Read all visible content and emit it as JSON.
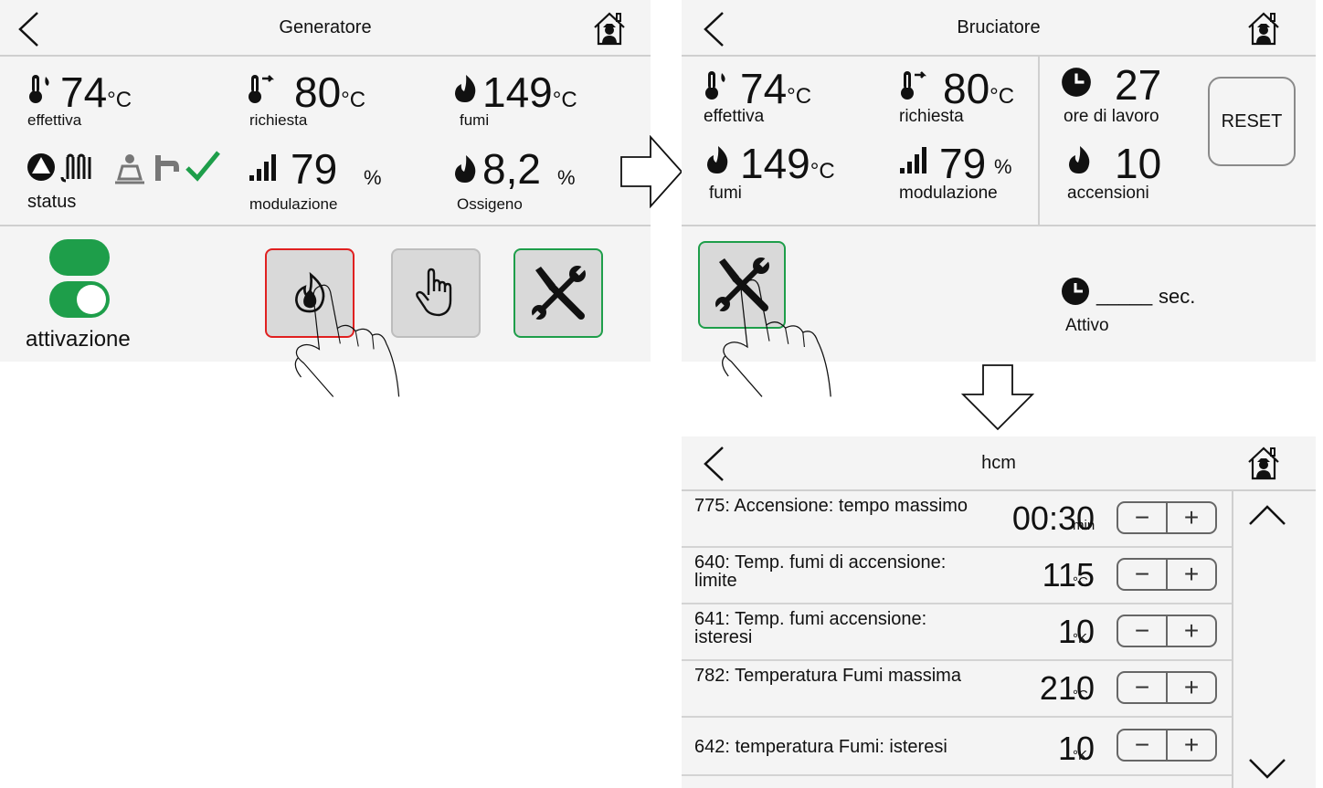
{
  "screen1": {
    "title": "Generatore",
    "effettiva_value": "74",
    "effettiva_unit": "°C",
    "effettiva_label": "effettiva",
    "richiesta_value": "80",
    "richiesta_unit": "°C",
    "richiesta_label": "richiesta",
    "fumi_value": "149",
    "fumi_unit": "°C",
    "fumi_label": "fumi",
    "status_label": "status",
    "modulazione_value": "79",
    "modulazione_unit": "%",
    "modulazione_label": "modulazione",
    "ossigeno_value": "8,2",
    "ossigeno_unit": "%",
    "ossigeno_label": "Ossigeno",
    "attivazione_label": "attivazione",
    "accent_green": "#1e9e4a",
    "accent_red": "#e02020"
  },
  "screen2": {
    "title": "Bruciatore",
    "effettiva_value": "74",
    "effettiva_unit": "°C",
    "effettiva_label": "effettiva",
    "richiesta_value": "80",
    "richiesta_unit": "°C",
    "richiesta_label": "richiesta",
    "ore_value": "27",
    "ore_label": "ore di lavoro",
    "fumi_value": "149",
    "fumi_unit": "°C",
    "fumi_label": "fumi",
    "modulazione_value": "79",
    "modulazione_unit": "%",
    "modulazione_label": "modulazione",
    "accensioni_value": "10",
    "accensioni_label": "accensioni",
    "reset_label": "RESET",
    "timer_blank": "_____",
    "timer_unit": "sec.",
    "attivo_label": "Attivo"
  },
  "screen3": {
    "title": "hcm",
    "params": [
      {
        "name": "775: Accensione: tempo massimo",
        "value": "00:30",
        "unit": "min"
      },
      {
        "name": "640: Temp. fumi di accensione: limite",
        "value": "115",
        "unit": "°C"
      },
      {
        "name": "641: Temp. fumi accensione: isteresi",
        "value": "10",
        "unit": "°K"
      },
      {
        "name": "782: Temperatura Fumi massima",
        "value": "210",
        "unit": "°C"
      },
      {
        "name": "642: temperatura Fumi: isteresi",
        "value": "10",
        "unit": "°K"
      }
    ],
    "minus_label": "−",
    "plus_label": "+"
  },
  "icons": [
    "back-arrow-icon",
    "home-icon",
    "thermometer-icon",
    "thermometer-setpoint-icon",
    "flame-icon",
    "pump-icon",
    "radiator-icon",
    "chimney-sweep-icon",
    "tap-icon",
    "check-icon",
    "signal-bars-icon",
    "toggle-icon",
    "burner-flame-icon",
    "hand-manual-icon",
    "tools-icon",
    "clock-icon",
    "hand-pointer-icon",
    "arrow-right-icon",
    "arrow-down-icon",
    "chevron-up-icon",
    "chevron-down-icon"
  ]
}
